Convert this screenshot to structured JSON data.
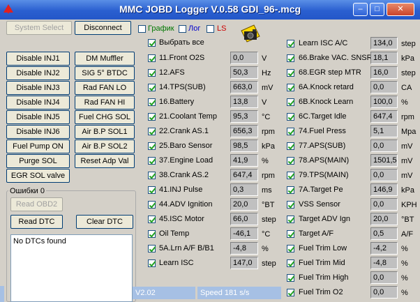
{
  "window": {
    "title": "MMC JOBD Logger V.0.58 GDI_96-.mcg"
  },
  "toolbar": {
    "system_select": "System Select",
    "disconnect": "Disconnect",
    "grafik": "График",
    "log": "Лог",
    "ls": "LS",
    "grafik_color": "#007700",
    "log_color": "#0000cc",
    "ls_color": "#cc0000"
  },
  "buttons_left": [
    "Disable INJ1",
    "Disable INJ2",
    "Disable INJ3",
    "Disable INJ4",
    "Disable INJ5",
    "Disable INJ6",
    "Fuel Pump ON",
    "Purge SOL",
    "EGR SOL valve"
  ],
  "buttons_mid": [
    "DM Muffler",
    "SIG 5° BTDC",
    "Rad FAN LO",
    "Rad FAN HI",
    "Fuel CHG SOL",
    "Air B.P SOL1",
    "Air B.P SOL2",
    "Reset Adp Val"
  ],
  "errors": {
    "label": "Ошибки 0",
    "read_obd2": "Read OBD2",
    "read_dtc": "Read DTC",
    "clear_dtc": "Clear DTC",
    "list": "No DTCs found"
  },
  "select_all": "Выбрать все",
  "sensors_col1": [
    {
      "name": "11.Front O2S",
      "value": "0,0",
      "unit": "V"
    },
    {
      "name": "12.AFS",
      "value": "50,3",
      "unit": "Hz"
    },
    {
      "name": "14.TPS(SUB)",
      "value": "663,0",
      "unit": "mV"
    },
    {
      "name": "16.Battery",
      "value": "13,8",
      "unit": "V"
    },
    {
      "name": "21.Coolant Temp",
      "value": "95,3",
      "unit": "°C"
    },
    {
      "name": "22.Crank AS.1",
      "value": "656,3",
      "unit": "rpm"
    },
    {
      "name": "25.Baro Sensor",
      "value": "98,5",
      "unit": "kPa"
    },
    {
      "name": "37.Engine Load",
      "value": "41,9",
      "unit": "%"
    },
    {
      "name": "38.Crank AS.2",
      "value": "647,4",
      "unit": "rpm"
    },
    {
      "name": "41.INJ Pulse",
      "value": "0,3",
      "unit": "ms"
    },
    {
      "name": "44.ADV Ignition",
      "value": "20,0",
      "unit": "°BT"
    },
    {
      "name": "45.ISC Motor",
      "value": "66,0",
      "unit": "step"
    },
    {
      "name": "Oil Temp",
      "value": "-46,1",
      "unit": "°C"
    },
    {
      "name": "5A.Lrn A/F B/B1",
      "value": "-4,8",
      "unit": "%"
    },
    {
      "name": "Learn ISC",
      "value": "147,0",
      "unit": "step"
    }
  ],
  "sensors_col2": [
    {
      "name": "Learn ISC A/C",
      "value": "134,0",
      "unit": "step"
    },
    {
      "name": "66.Brake VAC. SNSR",
      "value": "18,1",
      "unit": "kPa"
    },
    {
      "name": "68.EGR step MTR",
      "value": "16,0",
      "unit": "step"
    },
    {
      "name": "6A.Knock retard",
      "value": "0,0",
      "unit": "CA"
    },
    {
      "name": "6B.Knock Learn",
      "value": "100,0",
      "unit": "%"
    },
    {
      "name": "6C.Target Idle",
      "value": "647,4",
      "unit": "rpm"
    },
    {
      "name": "74.Fuel Press",
      "value": "5,1",
      "unit": "Mpa"
    },
    {
      "name": "77.APS(SUB)",
      "value": "0,0",
      "unit": "mV"
    },
    {
      "name": "78.APS(MAIN)",
      "value": "1501,5",
      "unit": "mV"
    },
    {
      "name": "79.TPS(MAIN)",
      "value": "0,0",
      "unit": "mV"
    },
    {
      "name": "7A.Target Pe",
      "value": "146,9",
      "unit": "kPa"
    },
    {
      "name": "VSS Sensor",
      "value": "0,0",
      "unit": "KPH"
    },
    {
      "name": "Target ADV Ign",
      "value": "20,0",
      "unit": "°BT"
    },
    {
      "name": "Target A/F",
      "value": "0,5",
      "unit": "A/F"
    },
    {
      "name": "Fuel Trim Low",
      "value": "-4,2",
      "unit": "%"
    },
    {
      "name": "Fuel Trim Mid",
      "value": "-4,8",
      "unit": "%"
    },
    {
      "name": "Fuel Trim High",
      "value": "0,0",
      "unit": "%"
    },
    {
      "name": "Fuel Trim O2",
      "value": "0,0",
      "unit": "%"
    }
  ],
  "status": {
    "version": "V2.02",
    "speed": "Speed 181 s/s"
  }
}
